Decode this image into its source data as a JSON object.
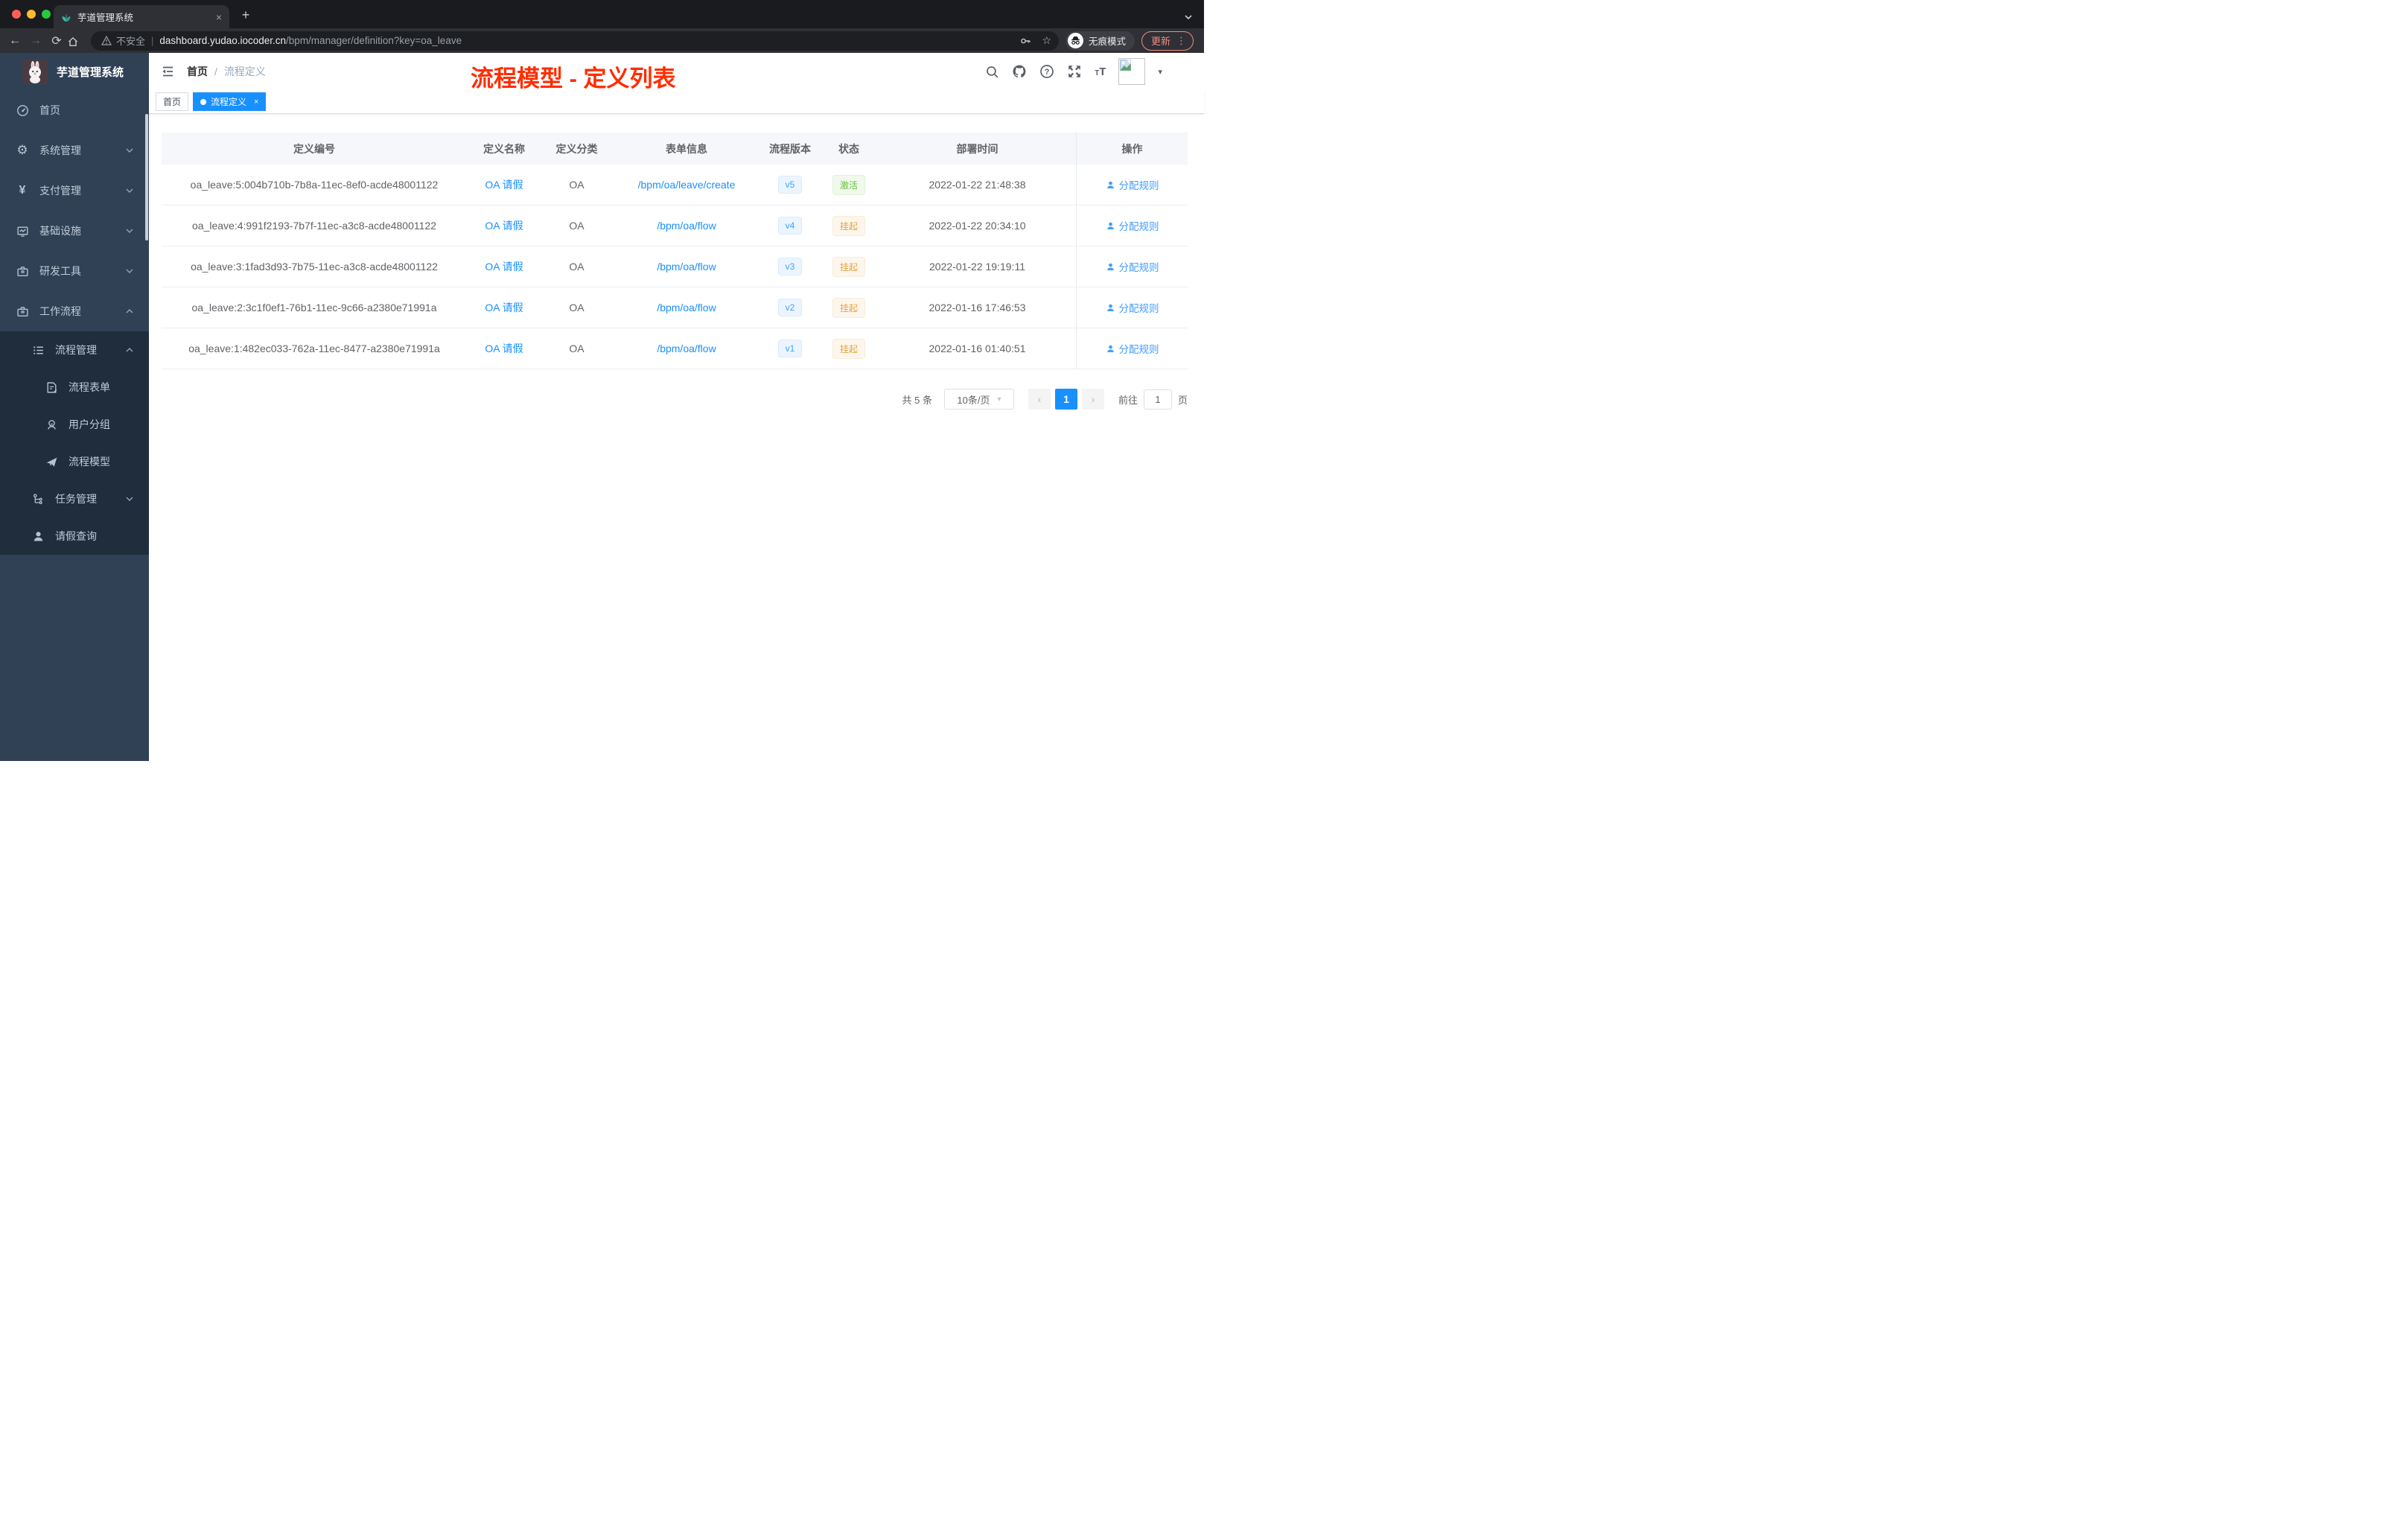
{
  "colors": {
    "primary": "#409eff",
    "link": "#1890ff",
    "tag_active": "#1890ff",
    "success_text": "#67c23a",
    "warning_text": "#e6a23c",
    "sidebar_bg": "#304156",
    "submenu_bg": "#1f2d3d",
    "annotation_red": "#ff2d00",
    "update_pill": "#f28b82"
  },
  "browser": {
    "tab_title": "芋道管理系统",
    "tab_close": "×",
    "new_tab": "+",
    "back": "←",
    "forward": "→",
    "reload": "⟳",
    "security_label": "不安全",
    "url_host": "dashboard.yudao.iocoder.cn",
    "url_path": "/bpm/manager/definition?key=oa_leave",
    "star": "☆",
    "incognito_label": "无痕模式",
    "update_label": "更新",
    "menu_dots": "⋮"
  },
  "icons": [
    "leaf-favicon",
    "warning-icon",
    "key-icon",
    "star-icon",
    "incognito-icon",
    "chevron-down-icon",
    "dashboard-icon",
    "gear-icon",
    "yen-icon",
    "monitor-icon",
    "briefcase-icon",
    "list-icon",
    "form-icon",
    "users-icon",
    "send-icon",
    "tree-icon",
    "person-icon",
    "hamburger-icon",
    "search-icon",
    "github-icon",
    "help-icon",
    "fullscreen-icon",
    "fontsize-icon",
    "broken-image-icon",
    "user-icon"
  ],
  "sidebar": {
    "logo_title": "芋道管理系统",
    "gear_glyph": "⚙",
    "yen_glyph": "¥",
    "menu": [
      {
        "label": "首页",
        "icon": "dashboard-icon"
      },
      {
        "label": "系统管理",
        "icon": "gear-icon"
      },
      {
        "label": "支付管理",
        "icon": "yen-icon"
      },
      {
        "label": "基础设施",
        "icon": "monitor-icon"
      },
      {
        "label": "研发工具",
        "icon": "briefcase-icon"
      },
      {
        "label": "工作流程",
        "icon": "briefcase-icon"
      },
      {
        "label": "流程管理",
        "icon": "list-icon"
      },
      {
        "label": "流程表单",
        "icon": "form-icon"
      },
      {
        "label": "用户分组",
        "icon": "users-icon"
      },
      {
        "label": "流程模型",
        "icon": "send-icon"
      },
      {
        "label": "任务管理",
        "icon": "tree-icon"
      },
      {
        "label": "请假查询",
        "icon": "person-icon"
      }
    ]
  },
  "header": {
    "breadcrumb_home": "首页",
    "breadcrumb_sep": "/",
    "breadcrumb_current": "流程定义",
    "annotation": "流程模型 - 定义列表"
  },
  "tags": {
    "home": "首页",
    "active": "流程定义",
    "close": "×"
  },
  "table": {
    "columns": [
      "定义编号",
      "定义名称",
      "定义分类",
      "表单信息",
      "流程版本",
      "状态",
      "部署时间",
      "操作"
    ],
    "rows": [
      {
        "id": "oa_leave:5:004b710b-7b8a-11ec-8ef0-acde48001122",
        "name": "OA 请假",
        "category": "OA",
        "form": "/bpm/oa/leave/create",
        "version": "v5",
        "status": "激活",
        "status_type": "success",
        "time": "2022-01-22 21:48:38",
        "action": "分配规则"
      },
      {
        "id": "oa_leave:4:991f2193-7b7f-11ec-a3c8-acde48001122",
        "name": "OA 请假",
        "category": "OA",
        "form": "/bpm/oa/flow",
        "version": "v4",
        "status": "挂起",
        "status_type": "warning",
        "time": "2022-01-22 20:34:10",
        "action": "分配规则"
      },
      {
        "id": "oa_leave:3:1fad3d93-7b75-11ec-a3c8-acde48001122",
        "name": "OA 请假",
        "category": "OA",
        "form": "/bpm/oa/flow",
        "version": "v3",
        "status": "挂起",
        "status_type": "warning",
        "time": "2022-01-22 19:19:11",
        "action": "分配规则"
      },
      {
        "id": "oa_leave:2:3c1f0ef1-76b1-11ec-9c66-a2380e71991a",
        "name": "OA 请假",
        "category": "OA",
        "form": "/bpm/oa/flow",
        "version": "v2",
        "status": "挂起",
        "status_type": "warning",
        "time": "2022-01-16 17:46:53",
        "action": "分配规则"
      },
      {
        "id": "oa_leave:1:482ec033-762a-11ec-8477-a2380e71991a",
        "name": "OA 请假",
        "category": "OA",
        "form": "/bpm/oa/flow",
        "version": "v1",
        "status": "挂起",
        "status_type": "warning",
        "time": "2022-01-16 01:40:51",
        "action": "分配规则"
      }
    ]
  },
  "pagination": {
    "total": "共 5 条",
    "page_size": "10条/页",
    "prev": "‹",
    "page": "1",
    "next": "›",
    "goto_label": "前往",
    "goto_value": "1",
    "page_unit": "页"
  }
}
